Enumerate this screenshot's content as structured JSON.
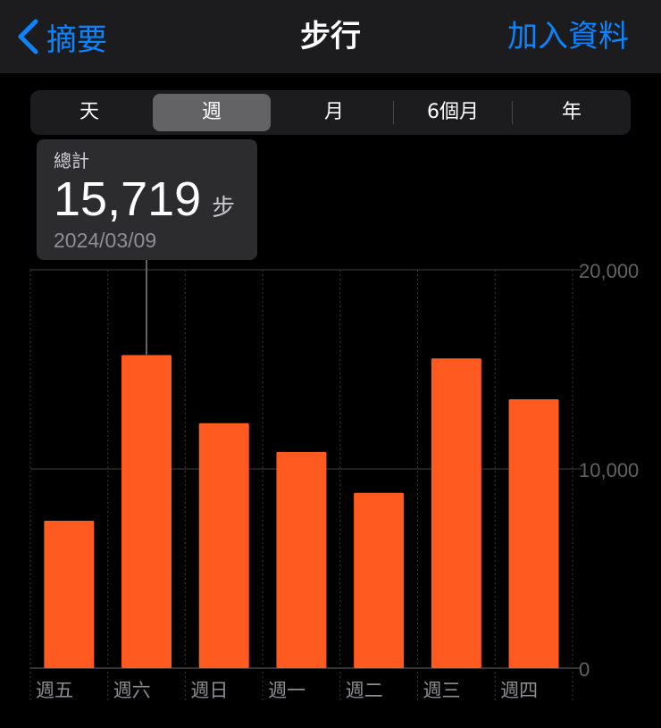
{
  "navbar": {
    "back_label": "摘要",
    "title": "步行",
    "add_label": "加入資料"
  },
  "segments": [
    {
      "label": "天",
      "active": false
    },
    {
      "label": "週",
      "active": true
    },
    {
      "label": "月",
      "active": false
    },
    {
      "label": "6個月",
      "active": false
    },
    {
      "label": "年",
      "active": false
    }
  ],
  "tooltip": {
    "label": "總計",
    "value": "15,719",
    "unit": "步",
    "date": "2024/03/09"
  },
  "colors": {
    "bar": "#ff5a1f",
    "accent": "#0a84ff"
  },
  "chart_data": {
    "type": "bar",
    "categories": [
      "週五",
      "週六",
      "週日",
      "週一",
      "週二",
      "週三",
      "週四"
    ],
    "values": [
      7400,
      15719,
      12300,
      10850,
      8800,
      15550,
      13500
    ],
    "ylim": [
      0,
      20000
    ],
    "yticks": [
      0,
      10000,
      20000
    ],
    "ytick_labels": [
      "0",
      "10,000",
      "20,000"
    ],
    "selected_index": 1
  }
}
